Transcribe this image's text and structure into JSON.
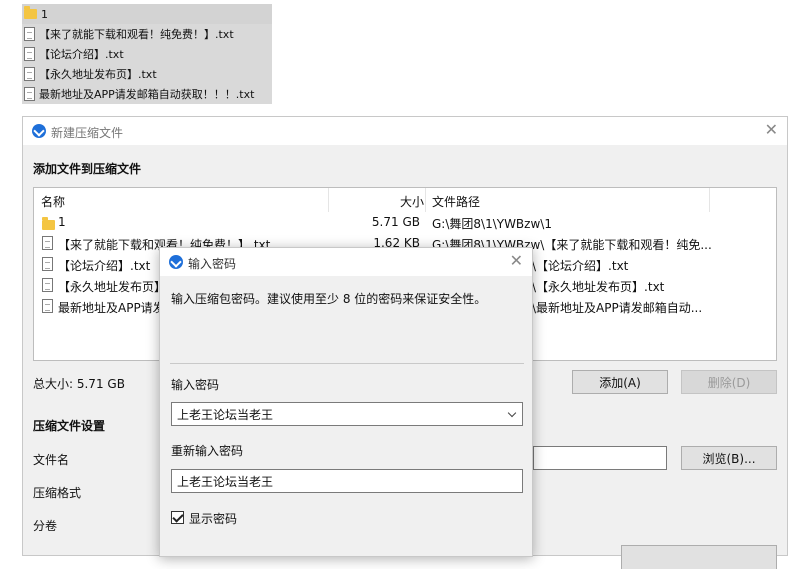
{
  "background_list": {
    "items": [
      {
        "type": "folder",
        "label": "1"
      },
      {
        "type": "file",
        "label": "【来了就能下载和观看！纯免费！】.txt"
      },
      {
        "type": "file",
        "label": "【论坛介绍】.txt"
      },
      {
        "type": "file",
        "label": "【永久地址发布页】.txt"
      },
      {
        "type": "file",
        "label": "最新地址及APP请发邮箱自动获取！！！.txt"
      }
    ]
  },
  "main_window": {
    "title": "新建压缩文件",
    "add_section_title": "添加文件到压缩文件",
    "columns": {
      "name": "名称",
      "size": "大小",
      "path": "文件路径"
    },
    "rows": [
      {
        "type": "folder",
        "name": "1",
        "size": "5.71 GB",
        "path": "G:\\舞团8\\1\\YWBzw\\1"
      },
      {
        "type": "file",
        "name": "【来了就能下载和观看！纯免费！】.txt",
        "size": "1.62 KB",
        "path": "G:\\舞团8\\1\\YWBzw\\【来了就能下载和观看！纯免..."
      },
      {
        "type": "file",
        "name": "【论坛介绍】.txt",
        "size": "",
        "path": "\\【论坛介绍】.txt"
      },
      {
        "type": "file",
        "name": "【永久地址发布页】",
        "size": "",
        "path": "\\【永久地址发布页】.txt"
      },
      {
        "type": "file",
        "name": "最新地址及APP请发",
        "size": "",
        "path": "\\最新地址及APP请发邮箱自动..."
      }
    ],
    "total_size_label": "总大小: 5.71 GB",
    "add_button": "添加(A)",
    "delete_button": "删除(D)",
    "settings_title": "压缩文件设置",
    "filename_label": "文件名",
    "format_label": "压缩格式",
    "split_label": "分卷",
    "browse_button": "浏览(B)..."
  },
  "password_dialog": {
    "title": "输入密码",
    "description": "输入压缩包密码。建议使用至少 8 位的密码来保证安全性。",
    "password_label": "输入密码",
    "password_value": "上老王论坛当老王",
    "confirm_label": "重新输入密码",
    "confirm_value": "上老王论坛当老王",
    "show_password_label": "显示密码"
  }
}
